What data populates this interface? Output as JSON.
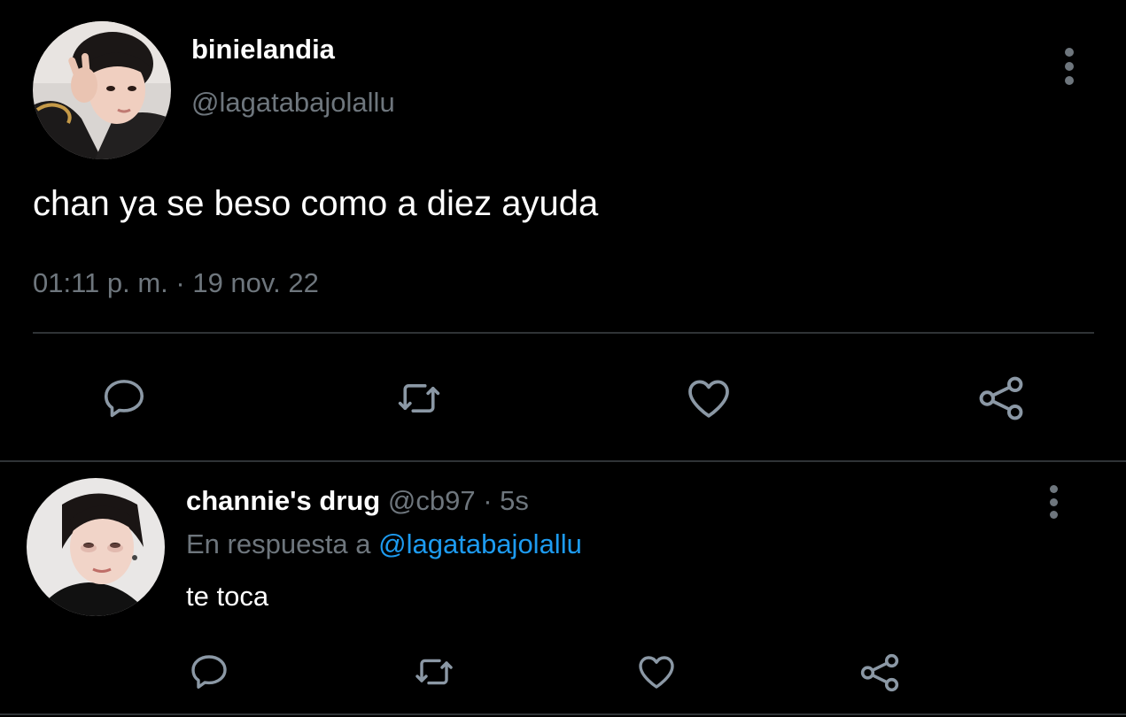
{
  "colors": {
    "background": "#000000",
    "text_primary": "#ffffff",
    "text_secondary": "#6e767d",
    "link": "#1d9bf0",
    "divider": "#2f3336"
  },
  "main_tweet": {
    "display_name": "binielandia",
    "handle": "@lagatabajolallu",
    "text": "chan ya se beso como a diez ayuda",
    "timestamp": "01:11 p. m. · 19 nov. 22",
    "actions": [
      {
        "icon": "reply-icon"
      },
      {
        "icon": "retweet-icon"
      },
      {
        "icon": "like-icon"
      },
      {
        "icon": "share-icon"
      }
    ]
  },
  "reply_tweet": {
    "display_name": "channie's drug",
    "handle": "@cb97",
    "separator": " · ",
    "age": "5s",
    "replying_to_prefix": "En respuesta a ",
    "replying_to_handle": "@lagatabajolallu",
    "text": "te toca",
    "actions": [
      {
        "icon": "reply-icon"
      },
      {
        "icon": "retweet-icon"
      },
      {
        "icon": "like-icon"
      },
      {
        "icon": "share-icon"
      }
    ]
  }
}
